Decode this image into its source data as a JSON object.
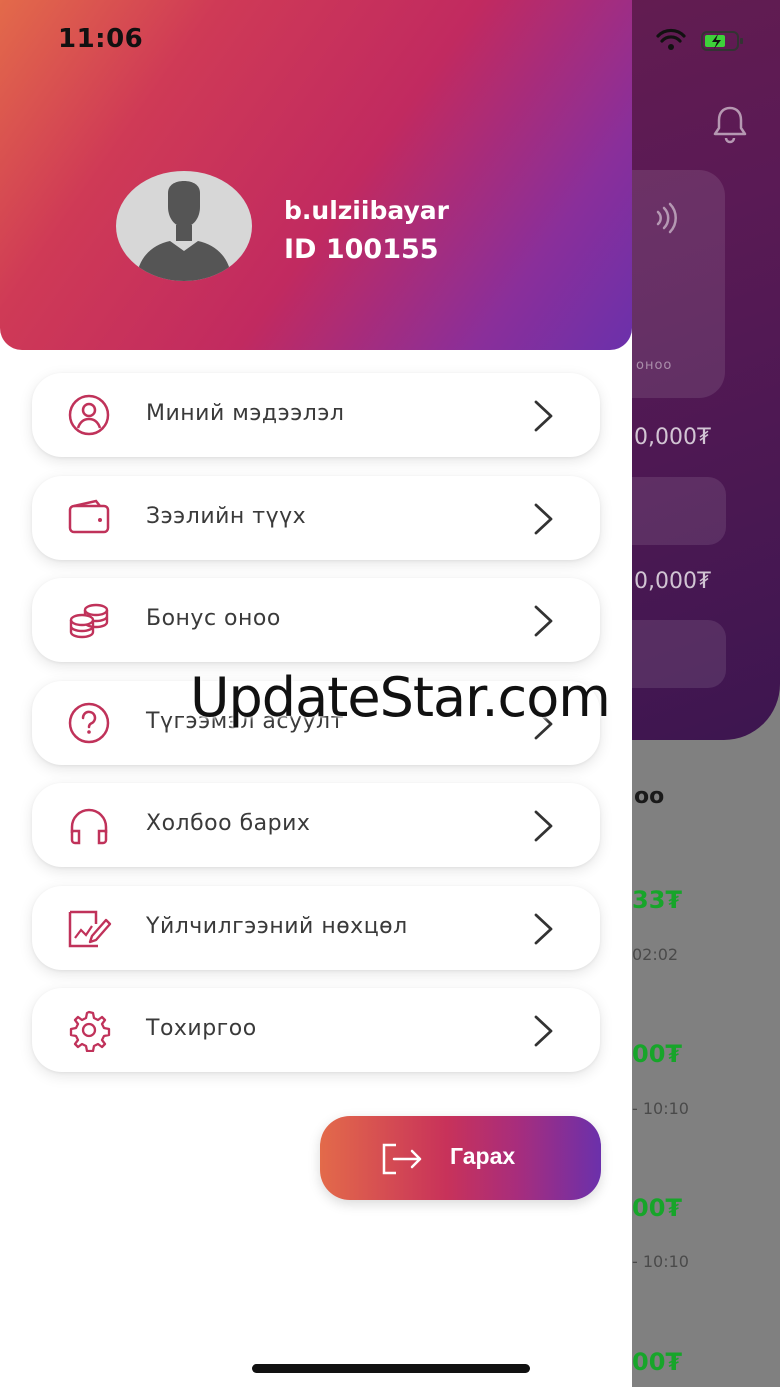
{
  "status_bar": {
    "time": "11:06"
  },
  "profile": {
    "username": "b.ulziibayar",
    "user_id": "ID 100155"
  },
  "menu": {
    "items": [
      {
        "label": "Миний мэдээлэл",
        "icon": "user-circle-icon"
      },
      {
        "label": "Зээлийн түүх",
        "icon": "wallet-icon"
      },
      {
        "label": "Бонус оноо",
        "icon": "coins-icon"
      },
      {
        "label": "Түгээмэл асуулт",
        "icon": "question-circle-icon"
      },
      {
        "label": "Холбоо барих",
        "icon": "headphones-icon"
      },
      {
        "label": "Үйлчилгээний нөхцөл",
        "icon": "document-sign-icon"
      },
      {
        "label": "Тохиргоо",
        "icon": "gear-icon"
      }
    ]
  },
  "logout": {
    "label": "Гарах"
  },
  "background_app": {
    "card_label": "оноо",
    "amount_1": "0,000₮",
    "amount_2": "0,000₮",
    "list_title": "оо",
    "rows": [
      {
        "amount": "33₮",
        "time": "02:02"
      },
      {
        "amount": "00₮",
        "time": "- 10:10"
      },
      {
        "amount": "00₮",
        "time": "- 10:10"
      },
      {
        "amount": "00₮",
        "time": ""
      }
    ]
  },
  "watermark": "UpdateStar.com",
  "colors": {
    "accent_start": "#e36a4a",
    "accent_mid": "#c12a60",
    "accent_end": "#6b30ab",
    "icon_color": "#c0325a",
    "green": "#17a52a"
  }
}
